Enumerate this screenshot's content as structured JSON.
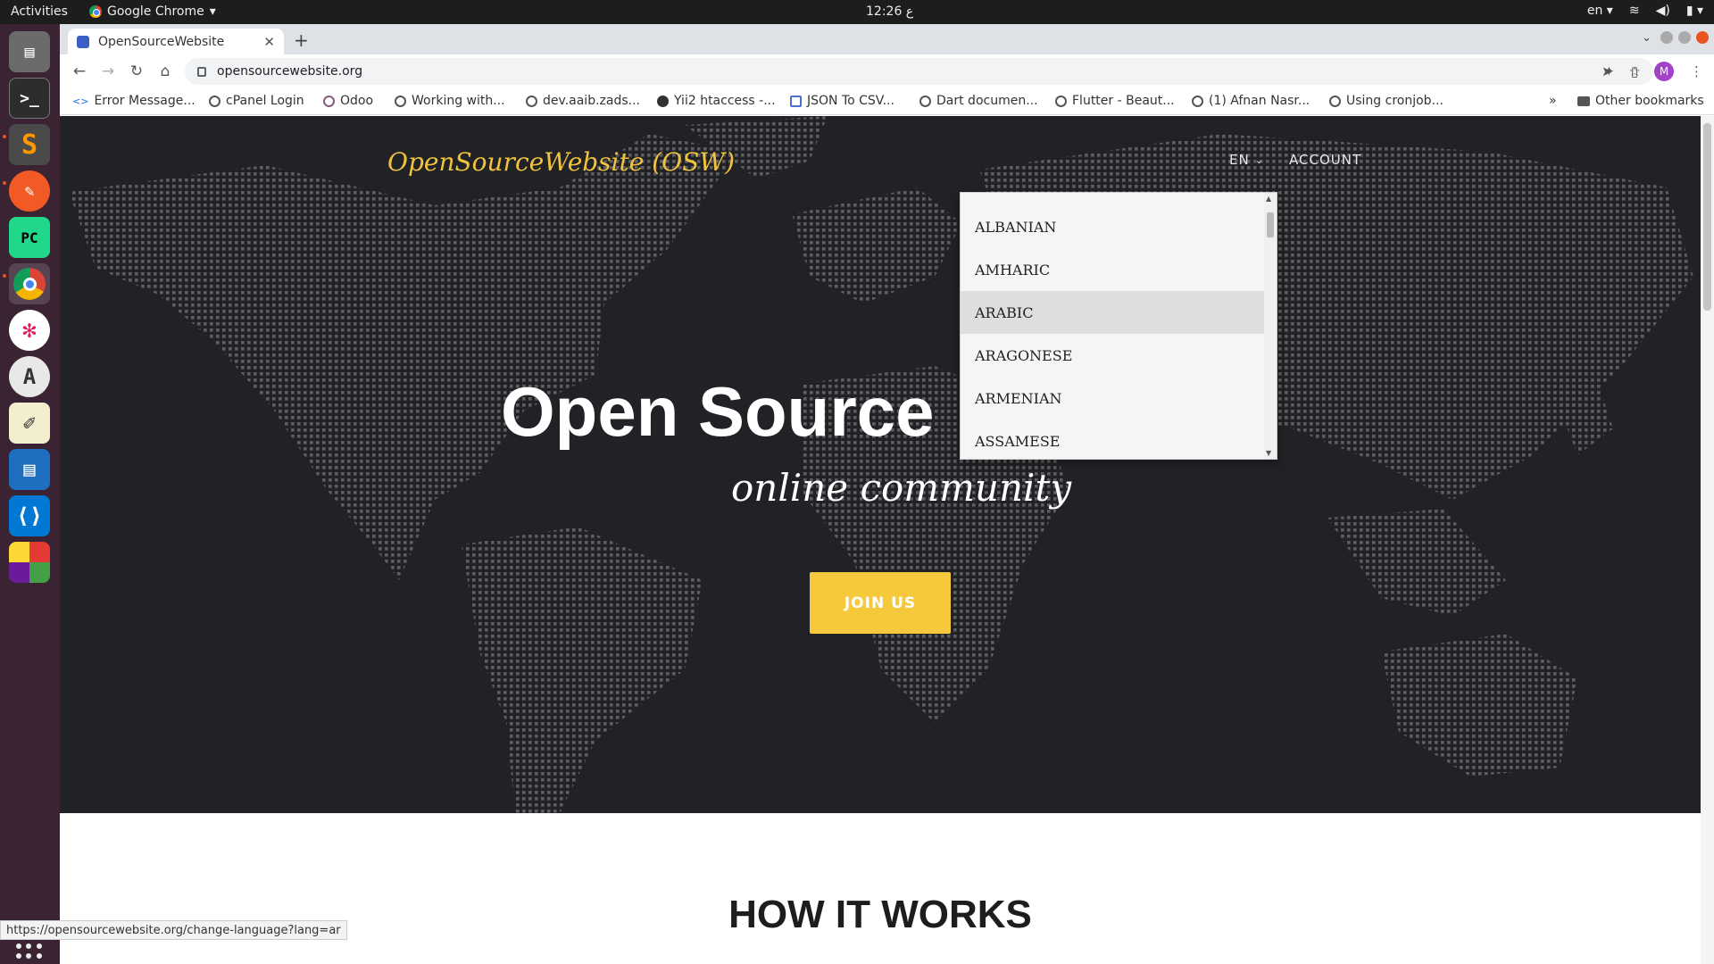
{
  "topbar": {
    "activities": "Activities",
    "app_name": "Google Chrome",
    "clock": "12:26 ع",
    "lang": "en"
  },
  "browser": {
    "tab_title": "OpenSourceWebsite",
    "url": "opensourcewebsite.org",
    "profile_initial": "M"
  },
  "bookmarks": {
    "items": [
      "Error Message...",
      "cPanel Login",
      "Odoo",
      "Working with...",
      "dev.aaib.zads...",
      "Yii2 htaccess -...",
      "JSON To CSV...",
      "Dart documen...",
      "Flutter - Beaut...",
      "(1) Afnan Nasr...",
      "Using cronjob..."
    ],
    "overflow": "»",
    "other": "Other bookmarks"
  },
  "site": {
    "brand": "OpenSourceWebsite (OSW)",
    "lang_button": "EN",
    "account": "ACCOUNT",
    "hero_title": "Open Source",
    "hero_subtitle": "online community",
    "join_button": "JOIN US",
    "how_heading": "HOW IT WORKS"
  },
  "language_menu": {
    "items": [
      "ALBANIAN",
      "AMHARIC",
      "ARABIC",
      "ARAGONESE",
      "ARMENIAN",
      "ASSAMESE"
    ],
    "hovered": "ARABIC"
  },
  "status_url": "https://opensourcewebsite.org/change-language?lang=ar",
  "colors": {
    "brand_yellow": "#f1c33d",
    "join_button": "#f6c93c",
    "hero_bg": "#202226"
  }
}
